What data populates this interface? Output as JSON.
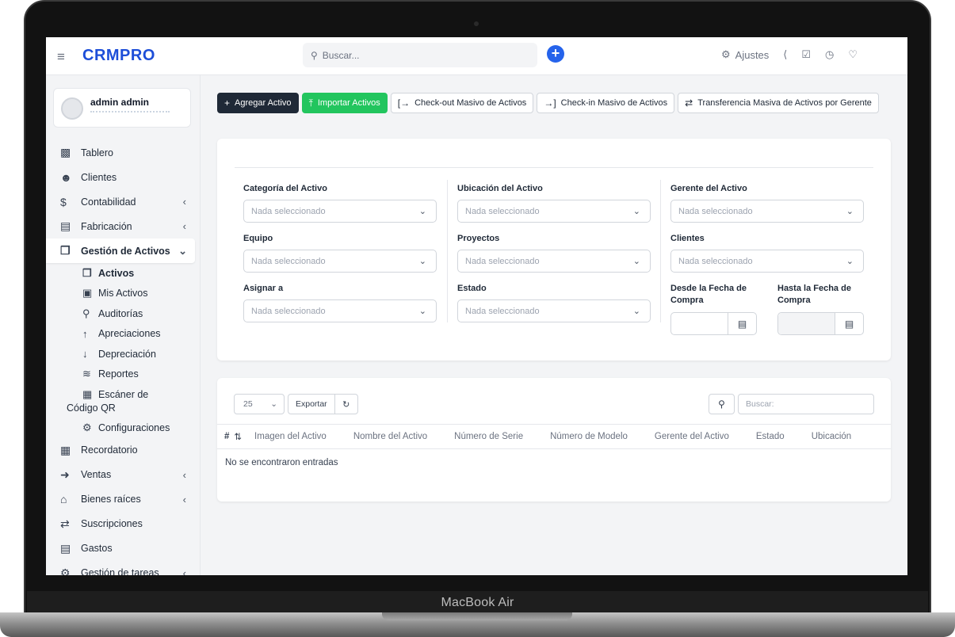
{
  "device": {
    "label": "MacBook Air"
  },
  "topbar": {
    "brand": "CRMPRO",
    "menu_icon": "menu-icon",
    "search_placeholder": "Buscar...",
    "settings_label": "Ajustes",
    "accent": "#2563eb"
  },
  "profile": {
    "name": "admin admin"
  },
  "sidebar": {
    "items": [
      {
        "label": "Tablero",
        "icon": "dashboard-icon",
        "chevron": false
      },
      {
        "label": "Clientes",
        "icon": "user-icon",
        "chevron": false
      },
      {
        "label": "Contabilidad",
        "icon": "dollar-icon",
        "chevron": true
      },
      {
        "label": "Fabricación",
        "icon": "factory-icon",
        "chevron": true
      },
      {
        "label": "Gestión de Activos",
        "icon": "box-icon",
        "chevron": true,
        "active": true
      }
    ],
    "subitems": [
      {
        "label": "Activos",
        "icon": "box-icon",
        "active": true
      },
      {
        "label": "Mis Activos",
        "icon": "briefcase-icon"
      },
      {
        "label": "Auditorías",
        "icon": "search-icon"
      },
      {
        "label": "Apreciaciones",
        "icon": "arrow-up-icon"
      },
      {
        "label": "Depreciación",
        "icon": "arrow-down-icon"
      },
      {
        "label": "Reportes",
        "icon": "chart-icon"
      },
      {
        "label": "Escáner de Código QR",
        "icon": "qr-icon"
      },
      {
        "label": "Configuraciones",
        "icon": "gear-icon"
      }
    ],
    "items_after": [
      {
        "label": "Recordatorio",
        "icon": "calendar-icon",
        "chevron": false
      },
      {
        "label": "Ventas",
        "icon": "bolt-icon",
        "chevron": true
      },
      {
        "label": "Bienes raíces",
        "icon": "house-icon",
        "chevron": true
      },
      {
        "label": "Suscripciones",
        "icon": "repeat-icon",
        "chevron": false
      },
      {
        "label": "Gastos",
        "icon": "file-icon",
        "chevron": false
      },
      {
        "label": "Gestión de tareas",
        "icon": "gears-icon",
        "chevron": true
      }
    ]
  },
  "actions": {
    "add": "Agregar Activo",
    "import": "Importar Activos",
    "checkout": "Check-out Masivo de Activos",
    "checkin": "Check-in Masivo de Activos",
    "transfer": "Transferencia Masiva de Activos por Gerente"
  },
  "filters": {
    "placeholder": "Nada seleccionado",
    "category": "Categoría del Activo",
    "location": "Ubicación del Activo",
    "manager": "Gerente del Activo",
    "equipment": "Equipo",
    "projects": "Proyectos",
    "clients": "Clientes",
    "assign": "Asignar a",
    "status": "Estado",
    "from_date": "Desde la Fecha de Compra",
    "to_date": "Hasta la Fecha de Compra"
  },
  "table": {
    "page_length": "25",
    "export_label": "Exportar",
    "search_placeholder": "Buscar:",
    "columns": [
      "#",
      "Imagen del Activo",
      "Nombre del Activo",
      "Número de Serie",
      "Número de Modelo",
      "Gerente del Activo",
      "Estado",
      "Ubicación"
    ],
    "empty_message": "No se encontraron entradas"
  }
}
